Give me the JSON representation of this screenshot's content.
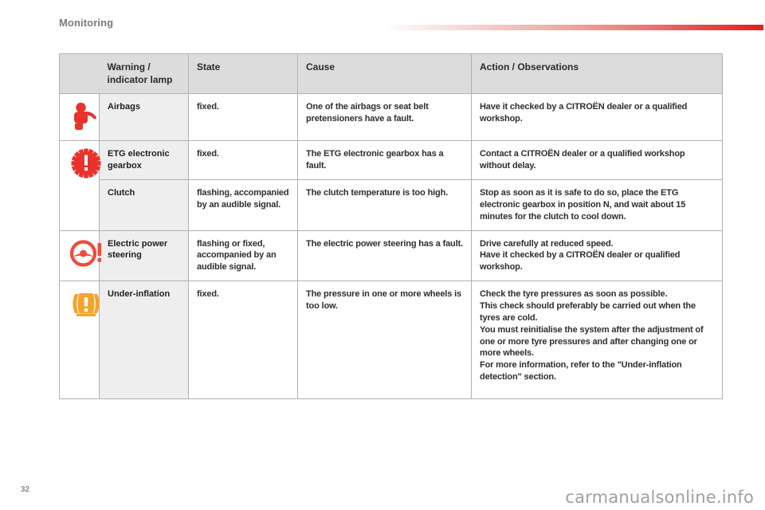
{
  "header": {
    "title": "Monitoring",
    "rule_color_start": "#ffffff",
    "rule_color_end": "#e0201c"
  },
  "table": {
    "columns": [
      {
        "key": "icon",
        "label": ""
      },
      {
        "key": "lamp",
        "label": "Warning / indicator lamp"
      },
      {
        "key": "state",
        "label": "State"
      },
      {
        "key": "cause",
        "label": "Cause"
      },
      {
        "key": "action",
        "label": "Action / Observations"
      }
    ],
    "rows": [
      {
        "icon": "airbag-warning-icon",
        "icon_color": "#e8322c",
        "lamp": "Airbags",
        "state": "fixed.",
        "cause": "One of the airbags or seat belt pretensioners have a fault.",
        "action": "Have it checked by a CITROËN dealer or a qualified workshop."
      },
      {
        "icon": "gearbox-fault-icon",
        "icon_color": "#e8322c",
        "lamp": "ETG electronic gearbox",
        "state": "fixed.",
        "cause": "The ETG electronic gearbox has a fault.",
        "action": "Contact a CITROËN dealer or a qualified workshop without delay."
      },
      {
        "icon": "",
        "icon_color": "",
        "lamp": "Clutch",
        "state": "flashing, accompanied by an audible signal.",
        "cause": "The clutch temperature is too high.",
        "action": "Stop as soon as it is safe to do so, place the ETG electronic gearbox in position N, and wait about 15 minutes for the clutch to cool down."
      },
      {
        "icon": "steering-wheel-fault-icon",
        "icon_color": "#ef4a3e",
        "lamp": "Electric power steering",
        "state": "flashing or fixed, accompanied by an audible signal.",
        "cause": "The electric power steering has a fault.",
        "action": "Drive carefully at reduced speed.\nHave it checked by a CITROËN dealer or qualified workshop."
      },
      {
        "icon": "tyre-under-inflation-icon",
        "icon_color": "#f5a32a",
        "lamp": "Under-inflation",
        "state": "fixed.",
        "cause": "The pressure in one or more wheels is too low.",
        "action": "Check the tyre pressures as soon as possible.\nThis check should preferably be carried out when the tyres are cold.\nYou must reinitialise the system after the adjustment of one or more tyre pressures and after changing one or more wheels.\nFor more information, refer to the \"Under-inflation detection\" section."
      }
    ]
  },
  "footer": {
    "page_number": "32",
    "watermark": "carmanualsonline.info"
  }
}
